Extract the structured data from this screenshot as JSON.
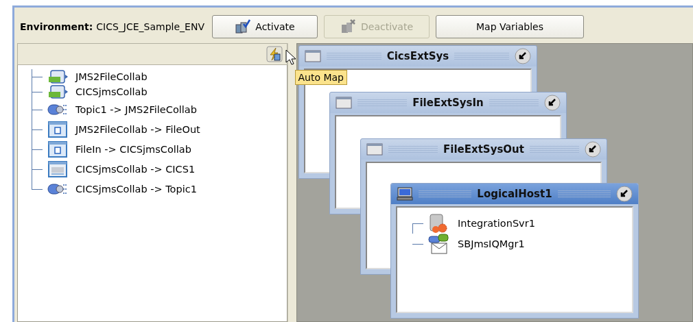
{
  "environment": {
    "label": "Environment:",
    "value": "CICS_JCE_Sample_ENV"
  },
  "buttons": [
    {
      "label": "Activate",
      "kind": "activate",
      "disabled": false
    },
    {
      "label": "Deactivate",
      "kind": "deactivate",
      "disabled": true
    },
    {
      "label": "Map Variables",
      "kind": "plain",
      "disabled": false
    }
  ],
  "tooltip": "Auto Map",
  "tree": [
    {
      "label": "JMS2FileCollab",
      "kind": "collab"
    },
    {
      "label": "CICSjmsCollab",
      "kind": "collab"
    },
    {
      "label": "Topic1 -> JMS2FileCollab",
      "kind": "topic"
    },
    {
      "label": "JMS2FileCollab -> FileOut",
      "kind": "file"
    },
    {
      "label": "FileIn -> CICSjmsCollab",
      "kind": "file"
    },
    {
      "label": "CICSjmsCollab -> CICS1",
      "kind": "cics"
    },
    {
      "label": "CICSjmsCollab -> Topic1",
      "kind": "topic"
    }
  ],
  "windows": [
    {
      "title": "CicsExtSys",
      "kind": "system",
      "active": false
    },
    {
      "title": "FileExtSysIn",
      "kind": "system",
      "active": false
    },
    {
      "title": "FileExtSysOut",
      "kind": "system",
      "active": false
    },
    {
      "title": "LogicalHost1",
      "kind": "host",
      "active": true,
      "children": [
        {
          "label": "IntegrationSvr1",
          "kind": "server"
        },
        {
          "label": "SBJmsIQMgr1",
          "kind": "queue"
        }
      ]
    }
  ]
}
